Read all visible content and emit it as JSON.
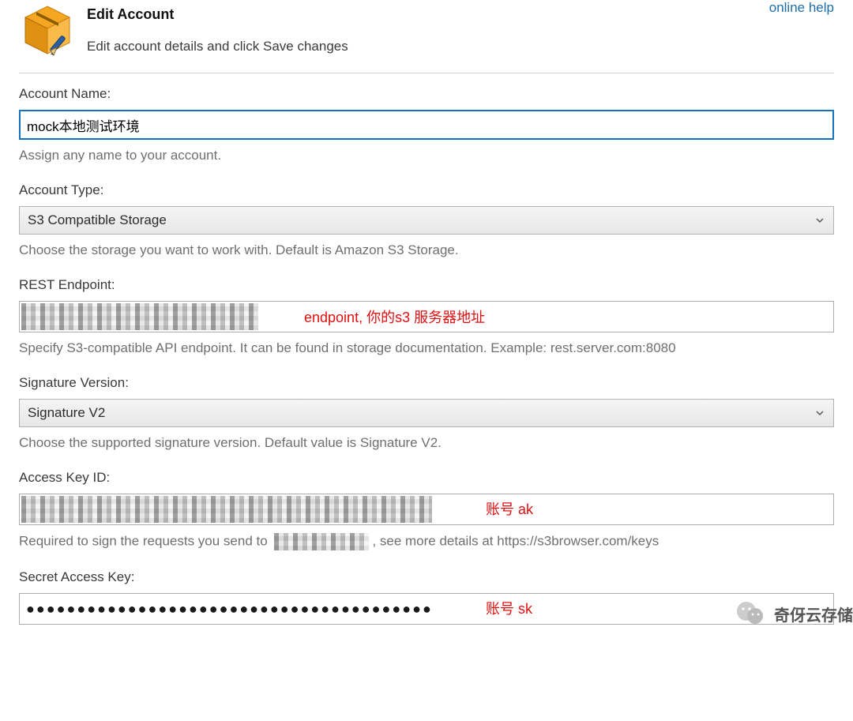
{
  "header": {
    "title": "Edit Account",
    "subtitle": "Edit account details and click Save changes",
    "help_link": "online help"
  },
  "account_name": {
    "label": "Account Name:",
    "value": "mock本地测试环境",
    "help": "Assign any name to your account."
  },
  "account_type": {
    "label": "Account Type:",
    "value": "S3 Compatible Storage",
    "help": "Choose the storage you want to work with. Default is Amazon S3 Storage."
  },
  "endpoint": {
    "label": "REST Endpoint:",
    "annotation": "endpoint, 你的s3 服务器地址",
    "help": "Specify S3-compatible API endpoint. It can be found in storage documentation. Example: rest.server.com:8080"
  },
  "signature": {
    "label": "Signature Version:",
    "value": "Signature V2",
    "help": "Choose the supported signature version. Default value is Signature V2."
  },
  "access_key": {
    "label": "Access Key ID:",
    "annotation": "账号 ak",
    "help_prefix": "Required to sign the requests you send to ",
    "help_suffix": ", see more details at https://s3browser.com/keys"
  },
  "secret_key": {
    "label": "Secret Access Key:",
    "annotation": "账号 sk",
    "value_masked": "●●●●●●●●●●●●●●●●●●●●●●●●●●●●●●●●●●●●●●●●"
  },
  "watermark": {
    "text": "奇伢云存储"
  }
}
